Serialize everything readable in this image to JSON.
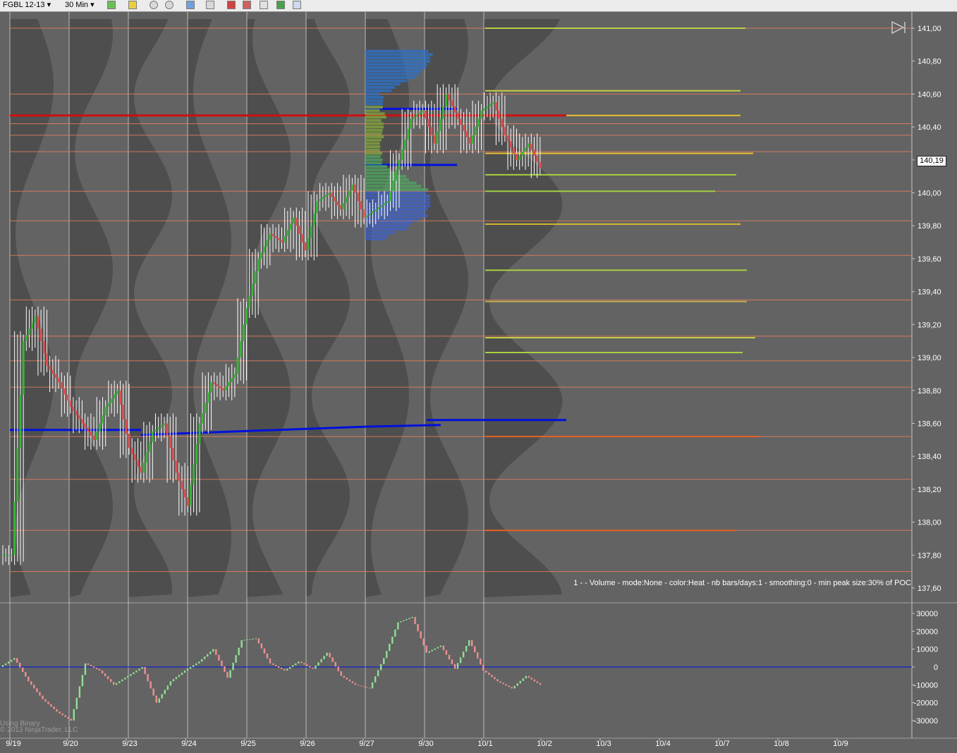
{
  "toolbar": {
    "instrument": "FGBL 12-13",
    "interval": "30 Min",
    "dropdown_arrow": "▾",
    "icons": [
      "bar-chart-icon",
      "pencil-icon",
      "zoom-in-icon",
      "zoom-out-icon",
      "crosshair-icon",
      "search-icon",
      "data-series-icon",
      "indicators-icon",
      "strategies-icon",
      "dollar-icon",
      "properties-icon"
    ]
  },
  "price_badge": "140,19",
  "status_text": "1 -  - Volume - mode:None - color:Heat - nb bars/days:1 - smoothing:0 - min peak size:30% of POC",
  "copyright": "© 2013 NinjaTrader, LLC",
  "binary_label": "Using Binary",
  "colors": {
    "background": "#636363",
    "profile": "#4a4a4a",
    "level_line": "#f08060",
    "poc_red": "#cc1111",
    "poc_blue": "#0010dd",
    "up_bar": "#3cb43c",
    "down_bar": "#e05050",
    "wick": "#ffffff"
  },
  "chart_data": {
    "type": "candlestick-market-profile",
    "price_axis": {
      "ticks": [
        "141,00",
        "140,80",
        "140,60",
        "140,40",
        "140,20",
        "140,00",
        "139,80",
        "139,60",
        "139,40",
        "139,20",
        "139,00",
        "138,80",
        "138,60",
        "138,40",
        "138,20",
        "138,00",
        "137,80",
        "137,60"
      ],
      "ylim": [
        137.5,
        141.08
      ]
    },
    "dates": [
      "9/19",
      "9/20",
      "9/23",
      "9/24",
      "9/25",
      "9/26",
      "9/27",
      "9/30",
      "10/1",
      "10/2",
      "10/3",
      "10/4",
      "10/7",
      "10/8",
      "10/9"
    ],
    "oscillator_axis": {
      "ticks": [
        "30000",
        "20000",
        "10000",
        "0",
        "-10000",
        "-20000",
        "-30000"
      ],
      "ylim": [
        -34000,
        34000
      ]
    },
    "reference_levels": [
      141.0,
      140.6,
      140.42,
      140.35,
      140.25,
      140.01,
      139.35,
      139.13,
      138.52,
      138.26,
      137.95,
      139.62,
      138.98,
      137.7,
      138.82,
      139.83
    ],
    "poc_lines": [
      {
        "color": "red",
        "price": 140.47
      },
      {
        "color": "blue",
        "price": 138.56
      }
    ],
    "candles_close": [
      137.8,
      139.1,
      139.25,
      138.95,
      138.85,
      138.7,
      138.6,
      138.5,
      138.7,
      138.8,
      138.45,
      138.3,
      138.55,
      138.6,
      138.3,
      138.1,
      138.6,
      138.85,
      138.8,
      138.9,
      139.3,
      139.6,
      139.75,
      139.7,
      139.85,
      139.65,
      139.95,
      140.0,
      139.9,
      140.05,
      139.85,
      139.9,
      139.95,
      140.2,
      140.45,
      140.5,
      140.3,
      140.6,
      140.45,
      140.3,
      140.5,
      140.55,
      140.35,
      140.2,
      140.3,
      140.15
    ],
    "oscillator_values": [
      5000,
      -8000,
      -18000,
      -25000,
      -30000,
      2000,
      -2000,
      -10000,
      -5000,
      0,
      -20000,
      -8000,
      -2000,
      3000,
      10000,
      -6000,
      15000,
      16000,
      2000,
      -2000,
      3000,
      -1000,
      8000,
      -5000,
      -10000,
      -12000,
      5000,
      25000,
      28000,
      8000,
      12000,
      -1000,
      15000,
      -2000,
      -8000,
      -12000,
      -5000,
      -10000
    ]
  }
}
